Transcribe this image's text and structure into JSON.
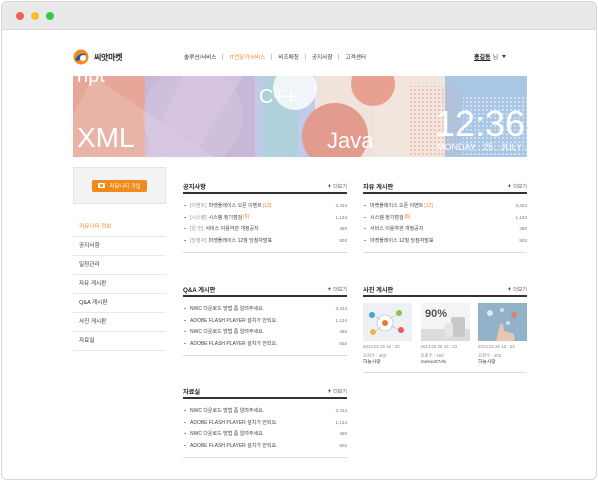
{
  "logo": {
    "text": "씨앗마켓"
  },
  "gnb": {
    "items": [
      {
        "label": "솔루션/서비스",
        "active": false
      },
      {
        "label": "IT전문가서비스",
        "active": true
      },
      {
        "label": "비즈매칭",
        "active": false
      },
      {
        "label": "공지사항",
        "active": false
      },
      {
        "label": "고객센터",
        "active": false
      }
    ]
  },
  "user": {
    "name": "홍길동",
    "suffix": "님"
  },
  "banner": {
    "words": [
      "hpt",
      "XML",
      "C++",
      "Java",
      "12:36"
    ],
    "date": "MONDAY . 25 . JULY . 2"
  },
  "sidebar": {
    "join_label": "커뮤니티 가입",
    "head": "커뮤니티 정보",
    "items": [
      "공지사항",
      "일정관리",
      "자유 게시판",
      "Q&A 게시판",
      "사진 게시판",
      "자료실"
    ]
  },
  "more_label": "더보기",
  "notice": {
    "title": "공지사항",
    "rows": [
      {
        "tag": "[이벤트]",
        "title": "마켓플레이스 오픈 이벤트",
        "count": "[12]",
        "num": "3,434"
      },
      {
        "tag": "[시스템]",
        "title": "시스템 정기점검",
        "count": "[6]",
        "num": "1,134"
      },
      {
        "tag": "[일    반]",
        "title": "서비스 이용약관 개정공지",
        "count": "",
        "num": "460"
      },
      {
        "tag": "[당첨자]",
        "title": "마켓플레이스 12월 당첨자발표",
        "count": "",
        "num": "502"
      }
    ]
  },
  "free": {
    "title": "자유 게시판",
    "rows": [
      {
        "title": "마켓플레이스 오픈 이벤트",
        "count": "[12]",
        "num": "3,434"
      },
      {
        "title": "시스템 정기점검",
        "count": "[6]",
        "num": "1,134"
      },
      {
        "title": "서비스 이용약관 개정공지",
        "count": "",
        "num": "460"
      },
      {
        "title": "마켓플레이스 12월 당첨자발표",
        "count": "",
        "num": "502"
      }
    ]
  },
  "qna": {
    "title": "Q&A 게시판",
    "rows": [
      {
        "title": "NWC 다운로드 방법 좀 알려주세요.",
        "num": "3,434"
      },
      {
        "title": "ADOBE FLASH PLAYER 설치가 안되요.",
        "num": "1,134"
      },
      {
        "title": "NWC 다운로드 방법 좀 알려주세요.",
        "num": "460"
      },
      {
        "title": "ADOBE FLASH PLAYER 설치가 안되요.",
        "num": "502"
      }
    ]
  },
  "files": {
    "title": "자료실",
    "rows": [
      {
        "title": "NWC 다운로드 방법 좀 알려주세요.",
        "num": "3,434"
      },
      {
        "title": "ADOBE FLASH PLAYER 설치가 안되요.",
        "num": "1,134"
      },
      {
        "title": "NWC 다운로드 방법 좀 알려주세요.",
        "num": "460"
      },
      {
        "title": "ADOBE FLASH PLAYER 설치가 안되요.",
        "num": "502"
      }
    ]
  },
  "photo": {
    "title": "사진 게시판",
    "items": [
      {
        "date": "2014.02.26 16 : 23",
        "views": "조회수 : 403",
        "name": "하늘사랑"
      },
      {
        "date": "2014.02.26 16 : 23",
        "views": "조회수 : 403",
        "name": "mesoo07Ab"
      },
      {
        "date": "2014.02.26 16 : 23",
        "views": "조회수 : 403",
        "name": "하늘사랑"
      }
    ]
  },
  "colors": {
    "accent": "#f28a1d",
    "join_button": "#f18a1c"
  }
}
